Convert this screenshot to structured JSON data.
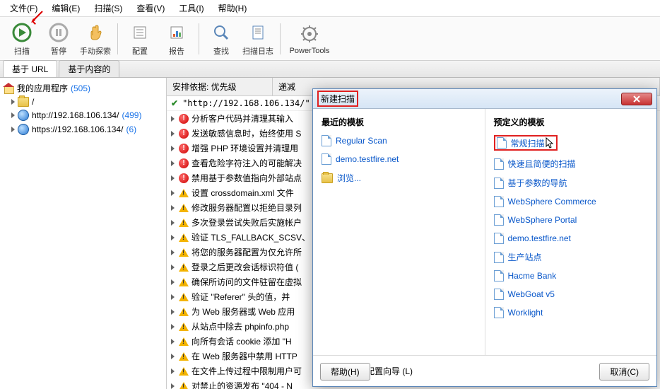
{
  "menu": {
    "file": "文件(F)",
    "edit": "编辑(E)",
    "scan": "扫描(S)",
    "view": "查看(V)",
    "tools": "工具(I)",
    "help": "帮助(H)"
  },
  "toolbar": {
    "scan": "扫描",
    "pause": "暂停",
    "manual": "手动探索",
    "config": "配置",
    "report": "报告",
    "find": "查找",
    "scanlog": "扫描日志",
    "power": "PowerTools"
  },
  "tabs": {
    "url": "基于 URL",
    "content": "基于内容的"
  },
  "tree": {
    "root": "我的应用程序",
    "root_count": "(505)",
    "items": [
      {
        "label": "/",
        "count": ""
      },
      {
        "label": "http://192.168.106.134/",
        "count": "(499)"
      },
      {
        "label": "https://192.168.106.134/",
        "count": "(6)"
      }
    ]
  },
  "center": {
    "col1": "安排依据: 优先级",
    "col2": "递减",
    "url": "\"http://192.168.106.134/\"",
    "issues": [
      {
        "sev": "r",
        "t": "分析客户代码并清理其输入"
      },
      {
        "sev": "r",
        "t": "发送敏感信息时，始终使用 S"
      },
      {
        "sev": "r",
        "t": "增强 PHP 环境设置并清理用"
      },
      {
        "sev": "r",
        "t": "查看危险字符注入的可能解决"
      },
      {
        "sev": "r",
        "t": "禁用基于参数值指向外部站点"
      },
      {
        "sev": "y",
        "t": "设置 crossdomain.xml 文件"
      },
      {
        "sev": "y",
        "t": "修改服务器配置以拒绝目录列"
      },
      {
        "sev": "y",
        "t": "多次登录尝试失败后实施帐户"
      },
      {
        "sev": "y",
        "t": "验证 TLS_FALLBACK_SCSV、"
      },
      {
        "sev": "y",
        "t": "将您的服务器配置为仅允许所"
      },
      {
        "sev": "y",
        "t": "登录之后更改会话标识符值 ("
      },
      {
        "sev": "y",
        "t": "确保所访问的文件驻留在虚拟"
      },
      {
        "sev": "y",
        "t": "验证 \"Referer\" 头的值，并"
      },
      {
        "sev": "y",
        "t": "为 Web 服务器或 Web 应用"
      },
      {
        "sev": "y",
        "t": "从站点中除去 phpinfo.php"
      },
      {
        "sev": "y",
        "t": "向所有会话 cookie 添加 \"H"
      },
      {
        "sev": "y",
        "t": "在 Web 服务器中禁用 HTTP"
      },
      {
        "sev": "y",
        "t": "在文件上传过程中限制用户可"
      },
      {
        "sev": "y",
        "t": "对禁止的资源发布 \"404 - N"
      }
    ]
  },
  "dialog": {
    "title": "新建扫描",
    "left_title": "最近的模板",
    "right_title": "预定义的模板",
    "recent": [
      {
        "label": "Regular Scan",
        "kind": "file"
      },
      {
        "label": "demo.testfire.net",
        "kind": "file"
      },
      {
        "label": "浏览...",
        "kind": "folder"
      }
    ],
    "predef": [
      {
        "label": "常规扫描",
        "framed": true
      },
      {
        "label": "快速且简便的扫描"
      },
      {
        "label": "基于参数的导航"
      },
      {
        "label": "WebSphere Commerce"
      },
      {
        "label": "WebSphere Portal"
      },
      {
        "label": "demo.testfire.net"
      },
      {
        "label": "生产站点"
      },
      {
        "label": "Hacme Bank"
      },
      {
        "label": "WebGoat v5"
      },
      {
        "label": "Worklight"
      }
    ],
    "wizard": "启动扫描配置向导 (L)",
    "help": "帮助(H)",
    "cancel": "取消(C)"
  }
}
